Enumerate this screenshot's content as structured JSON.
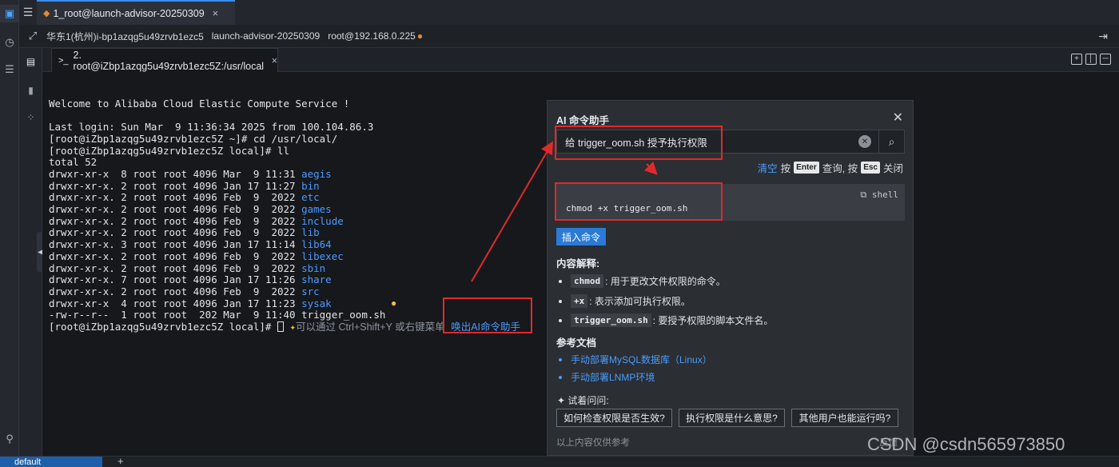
{
  "window": {
    "tab_title": "1_root@launch-advisor-20250309",
    "tab_close": "×"
  },
  "info": {
    "region": "华东1(杭州)i-bp1azqg5u49zrvb1ezc5",
    "instance": "launch-advisor-20250309",
    "user_host": "root@192.168.0.225"
  },
  "session": {
    "tab_label": "2. root@iZbp1azqg5u49zrvb1ezc5Z:/usr/local",
    "tab_close": "×"
  },
  "terminal": {
    "welcome": "Welcome to Alibaba Cloud Elastic Compute Service !",
    "last_login": "Last login: Sun Mar  9 11:36:34 2025 from 100.104.86.3",
    "cmd1": "[root@iZbp1azqg5u49zrvb1ezc5Z ~]# cd /usr/local/",
    "cmd2": "[root@iZbp1azqg5u49zrvb1ezc5Z local]# ll",
    "total": "total 52",
    "listing": [
      {
        "meta": "drwxr-xr-x  8 root root 4096 Mar  9 11:31 ",
        "name": "aegis",
        "dir": true
      },
      {
        "meta": "drwxr-xr-x. 2 root root 4096 Jan 17 11:27 ",
        "name": "bin",
        "dir": true
      },
      {
        "meta": "drwxr-xr-x. 2 root root 4096 Feb  9  2022 ",
        "name": "etc",
        "dir": true
      },
      {
        "meta": "drwxr-xr-x. 2 root root 4096 Feb  9  2022 ",
        "name": "games",
        "dir": true
      },
      {
        "meta": "drwxr-xr-x. 2 root root 4096 Feb  9  2022 ",
        "name": "include",
        "dir": true
      },
      {
        "meta": "drwxr-xr-x. 2 root root 4096 Feb  9  2022 ",
        "name": "lib",
        "dir": true
      },
      {
        "meta": "drwxr-xr-x. 3 root root 4096 Jan 17 11:14 ",
        "name": "lib64",
        "dir": true
      },
      {
        "meta": "drwxr-xr-x. 2 root root 4096 Feb  9  2022 ",
        "name": "libexec",
        "dir": true
      },
      {
        "meta": "drwxr-xr-x. 2 root root 4096 Feb  9  2022 ",
        "name": "sbin",
        "dir": true
      },
      {
        "meta": "drwxr-xr-x. 7 root root 4096 Jan 17 11:26 ",
        "name": "share",
        "dir": true
      },
      {
        "meta": "drwxr-xr-x. 2 root root 4096 Feb  9  2022 ",
        "name": "src",
        "dir": true
      },
      {
        "meta": "drwxr-xr-x  4 root root 4096 Jan 17 11:23 ",
        "name": "sysak",
        "dir": true
      },
      {
        "meta": "-rw-r--r--  1 root root  202 Mar  9 11:40 ",
        "name": "trigger_oom.sh",
        "dir": false
      }
    ],
    "prompt": "[root@iZbp1azqg5u49zrvb1ezc5Z local]# ",
    "hint": "可以通过 Ctrl+Shift+Y 或右键菜单",
    "call_ai": "唤出AI命令助手"
  },
  "ai_panel": {
    "title": "AI 命令助手",
    "query": "给 trigger_oom.sh 授予执行权限",
    "hint_clear": "清空",
    "hint_press1": "按",
    "kbd_enter": "Enter",
    "hint_query": "查询, 按",
    "kbd_esc": "Esc",
    "hint_close": "关闭",
    "command": "chmod +x trigger_oom.sh",
    "lang": "shell",
    "insert_button": "插入命令",
    "explain_title": "内容解释:",
    "explanations": [
      {
        "code": "chmod",
        "text": ": 用于更改文件权限的命令。"
      },
      {
        "code": "+x",
        "text": ": 表示添加可执行权限。"
      },
      {
        "code": "trigger_oom.sh",
        "text": ": 要授予权限的脚本文件名。"
      }
    ],
    "refs_title": "参考文档",
    "refs": [
      "手动部署MySQL数据库（Linux）",
      "手动部署LNMP环境"
    ],
    "try_title": "试着问问:",
    "try_questions": [
      "如何检查权限是否生效?",
      "执行权限是什么意思?",
      "其他用户也能运行吗?"
    ],
    "disclaimer": "以上内容仅供参考",
    "disclaimer_right": "反馈"
  },
  "status": {
    "session_name": "default",
    "add": "+"
  },
  "watermark": "CSDN @csdn565973850",
  "colors": {
    "accent": "#3b8cf0",
    "link": "#4a9bff",
    "annotation_red": "#e02a2a",
    "terminal_bg": "#16181c"
  }
}
